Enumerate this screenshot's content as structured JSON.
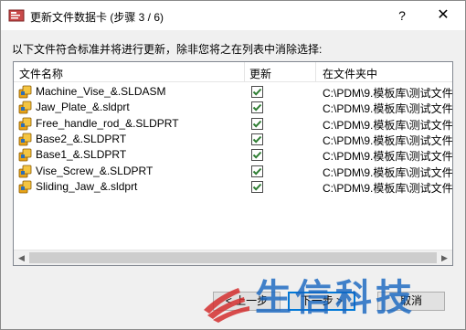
{
  "window": {
    "title": "更新文件数据卡 (步骤 3 / 6)",
    "help_label": "?",
    "close_label": "✕"
  },
  "instruction": "以下文件符合标准并将进行更新，除非您将之在列表中消除选择:",
  "columns": {
    "name": "文件名称",
    "update": "更新",
    "folder": "在文件夹中"
  },
  "files": [
    {
      "name": "Machine_Vise_&.SLDASM",
      "checked": true,
      "folder": "C:\\PDM\\9.模板库\\测试文件"
    },
    {
      "name": "Jaw_Plate_&.sldprt",
      "checked": true,
      "folder": "C:\\PDM\\9.模板库\\测试文件"
    },
    {
      "name": "Free_handle_rod_&.SLDPRT",
      "checked": true,
      "folder": "C:\\PDM\\9.模板库\\测试文件"
    },
    {
      "name": "Base2_&.SLDPRT",
      "checked": true,
      "folder": "C:\\PDM\\9.模板库\\测试文件"
    },
    {
      "name": "Base1_&.SLDPRT",
      "checked": true,
      "folder": "C:\\PDM\\9.模板库\\测试文件"
    },
    {
      "name": "Vise_Screw_&.SLDPRT",
      "checked": true,
      "folder": "C:\\PDM\\9.模板库\\测试文件"
    },
    {
      "name": "Sliding_Jaw_&.sldprt",
      "checked": true,
      "folder": "C:\\PDM\\9.模板库\\测试文件"
    }
  ],
  "buttons": {
    "back": "< 上一步",
    "next": "下一步 >",
    "cancel": "取消"
  },
  "watermark": {
    "text": "生信科技"
  },
  "colors": {
    "check_green": "#2e7d32",
    "watermark_red": "#d32f2f",
    "watermark_blue": "#1565c0"
  }
}
